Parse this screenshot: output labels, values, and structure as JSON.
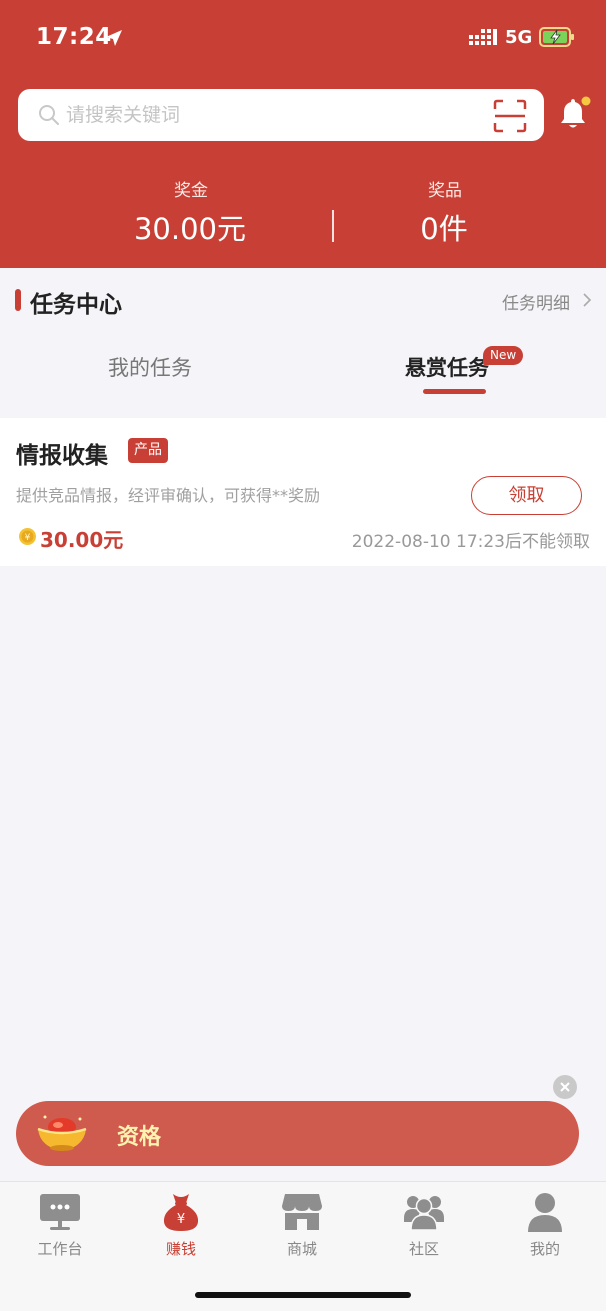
{
  "status_bar": {
    "time": "17:24",
    "network": "5G"
  },
  "search": {
    "placeholder": "请搜索关键词"
  },
  "stats": {
    "bonus_label": "奖金",
    "bonus_value": "30.00元",
    "prize_label": "奖品",
    "prize_value": "0件"
  },
  "task_center": {
    "title": "任务中心",
    "detail_link": "任务明细",
    "tabs": [
      {
        "label": "我的任务",
        "active": false
      },
      {
        "label": "悬赏任务",
        "active": true,
        "badge": "New"
      }
    ]
  },
  "tasks": [
    {
      "title": "情报收集",
      "tag": "产品",
      "description": "提供竞品情报，经评审确认，可获得**奖励",
      "button": "领取",
      "reward": "30.00元",
      "deadline": "2022-08-10 17:23后不能领取"
    }
  ],
  "banner": {
    "text": "资格"
  },
  "tabbar": {
    "items": [
      {
        "label": "工作台",
        "icon": "workbench-icon",
        "active": false
      },
      {
        "label": "赚钱",
        "icon": "money-bag-icon",
        "active": true
      },
      {
        "label": "商城",
        "icon": "store-icon",
        "active": false
      },
      {
        "label": "社区",
        "icon": "community-icon",
        "active": false
      },
      {
        "label": "我的",
        "icon": "profile-icon",
        "active": false
      }
    ]
  },
  "colors": {
    "brand_red": "#c84035",
    "banner_red": "#cf5a4e",
    "background": "#f5f5f9",
    "notify_dot": "#f5c842"
  }
}
